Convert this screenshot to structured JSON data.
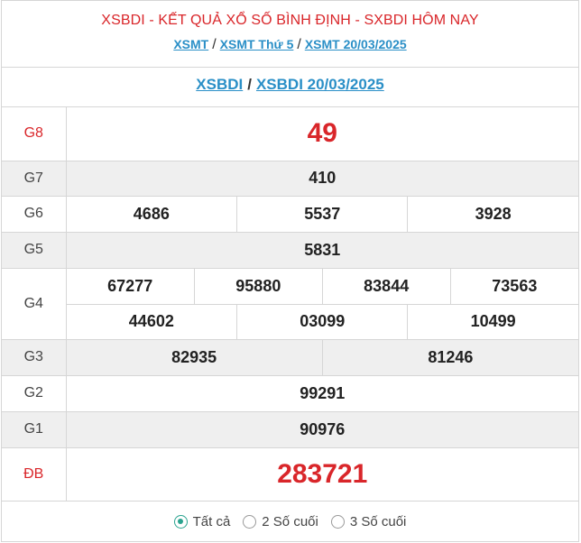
{
  "header": {
    "title": "XSBDI - KẾT QUẢ XỔ SỐ BÌNH ĐỊNH - SXBDI HÔM NAY",
    "breadcrumbs": [
      {
        "label": "XSMT"
      },
      {
        "label": "XSMT Thứ 5"
      },
      {
        "label": "XSMT 20/03/2025"
      }
    ],
    "separator": "/"
  },
  "subheader": {
    "link1": "XSBDI",
    "link2": "XSBDI 20/03/2025",
    "separator": "/"
  },
  "prizes": {
    "g8": {
      "label": "G8",
      "numbers": [
        "49"
      ]
    },
    "g7": {
      "label": "G7",
      "numbers": [
        "410"
      ]
    },
    "g6": {
      "label": "G6",
      "numbers": [
        "4686",
        "5537",
        "3928"
      ]
    },
    "g5": {
      "label": "G5",
      "numbers": [
        "5831"
      ]
    },
    "g4": {
      "label": "G4",
      "numbers": [
        "67277",
        "95880",
        "83844",
        "73563",
        "44602",
        "03099",
        "10499"
      ]
    },
    "g3": {
      "label": "G3",
      "numbers": [
        "82935",
        "81246"
      ]
    },
    "g2": {
      "label": "G2",
      "numbers": [
        "99291"
      ]
    },
    "g1": {
      "label": "G1",
      "numbers": [
        "90976"
      ]
    },
    "db": {
      "label": "ĐB",
      "numbers": [
        "283721"
      ]
    }
  },
  "filter": {
    "options": [
      "Tất cả",
      "2 Số cuối",
      "3 Số cuối"
    ],
    "selected": "Tất cả"
  },
  "colors": {
    "accent_red": "#d9262a",
    "link_blue": "#2a8fc7",
    "radio_green": "#2aa38f"
  }
}
